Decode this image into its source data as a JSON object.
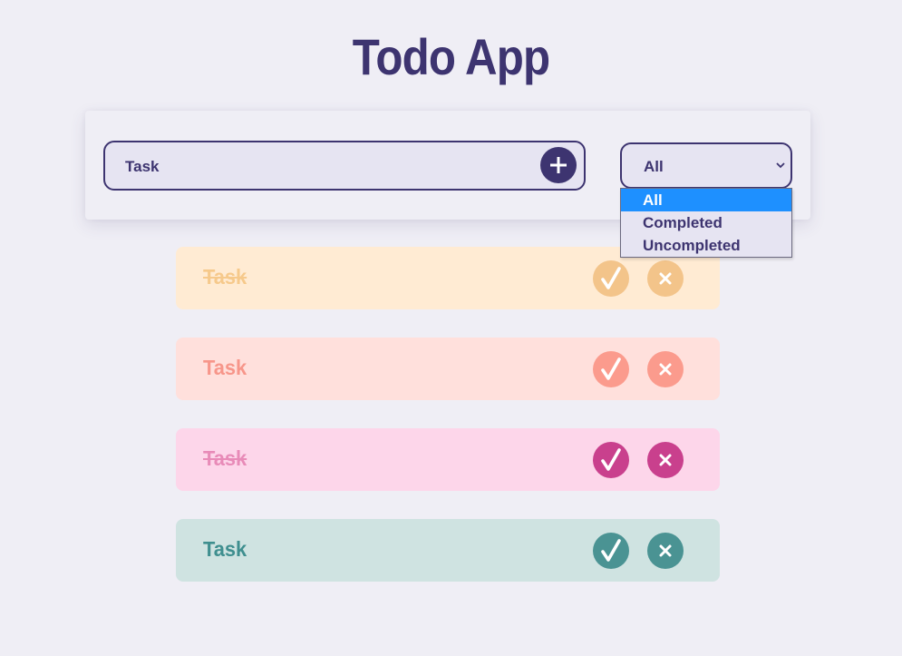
{
  "app": {
    "title": "Todo App"
  },
  "task_input": {
    "value": "Task",
    "placeholder": "Task"
  },
  "filter": {
    "selected": "All",
    "options": [
      "All",
      "Completed",
      "Uncompleted"
    ]
  },
  "todos": [
    {
      "text": "Task",
      "completed": true,
      "bg": "#ffebd3",
      "text_color": "#f6c98b",
      "button_color": "#f3c48a"
    },
    {
      "text": "Task",
      "completed": false,
      "bg": "#ffe0dc",
      "text_color": "#f7968a",
      "button_color": "#fb9b8d"
    },
    {
      "text": "Task",
      "completed": true,
      "bg": "#fdd6ea",
      "text_color": "#e88bb8",
      "button_color": "#c9408d"
    },
    {
      "text": "Task",
      "completed": false,
      "bg": "#cfe3e1",
      "text_color": "#3f8f8f",
      "button_color": "#4a9393"
    }
  ],
  "colors": {
    "primary": "#3d3470",
    "background": "#efeef5",
    "highlight": "#1e90ff"
  },
  "icons": {
    "add": "plus-icon",
    "check": "check-icon",
    "delete": "close-icon",
    "chevron": "chevron-down-icon"
  }
}
